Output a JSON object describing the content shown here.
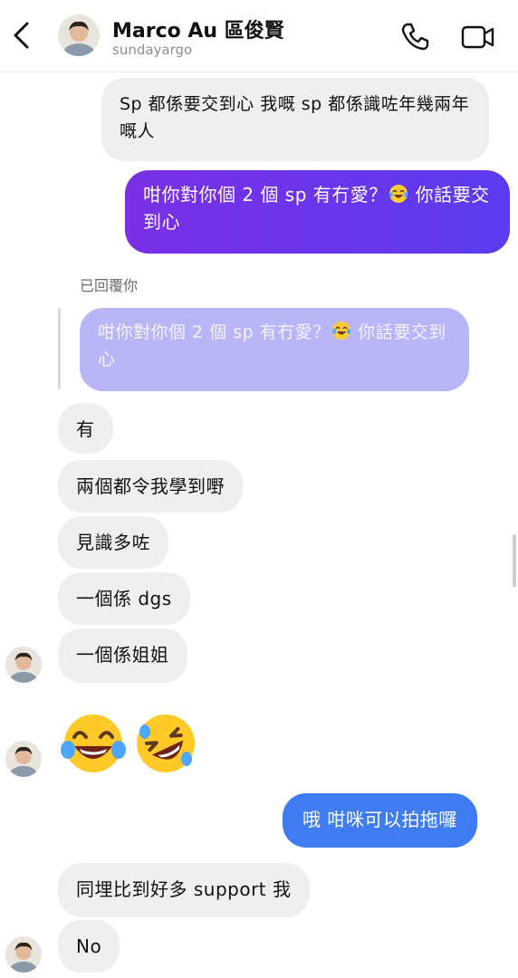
{
  "header": {
    "name": "Marco Au 區俊賢",
    "username": "sundayargo"
  },
  "messages": {
    "m1": "Sp 都係要交到心 我嘅 sp 都係識咗年幾兩年嘅人",
    "m2_a": "咁你對你個 2 個 sp 有冇愛？",
    "m2_b": " 你話要交到心",
    "reply_label": "已回覆你",
    "quote_a": "咁你對你個 2 個 sp 有冇愛？",
    "quote_b": " 你話要交到心",
    "m3": "有",
    "m4": "兩個都令我學到嘢",
    "m5": "見識多咗",
    "m6": "一個係 dgs",
    "m7": "一個係姐姐",
    "m8": "哦 咁咪可以拍拖囉",
    "m9": "同埋比到好多 support 我",
    "m10": "No"
  },
  "icons": {
    "back": "chevron-left-icon",
    "call": "phone-icon",
    "video": "video-camera-icon",
    "emoji_laugh": "tears-of-joy-emoji",
    "emoji_rofl": "rolling-on-floor-laughing-emoji"
  },
  "colors": {
    "outgoing_purple": "#6a35ec",
    "outgoing_blue": "#3f7cf2",
    "incoming_gray": "#efefef",
    "quote_lilac": "#b8b6f7"
  }
}
